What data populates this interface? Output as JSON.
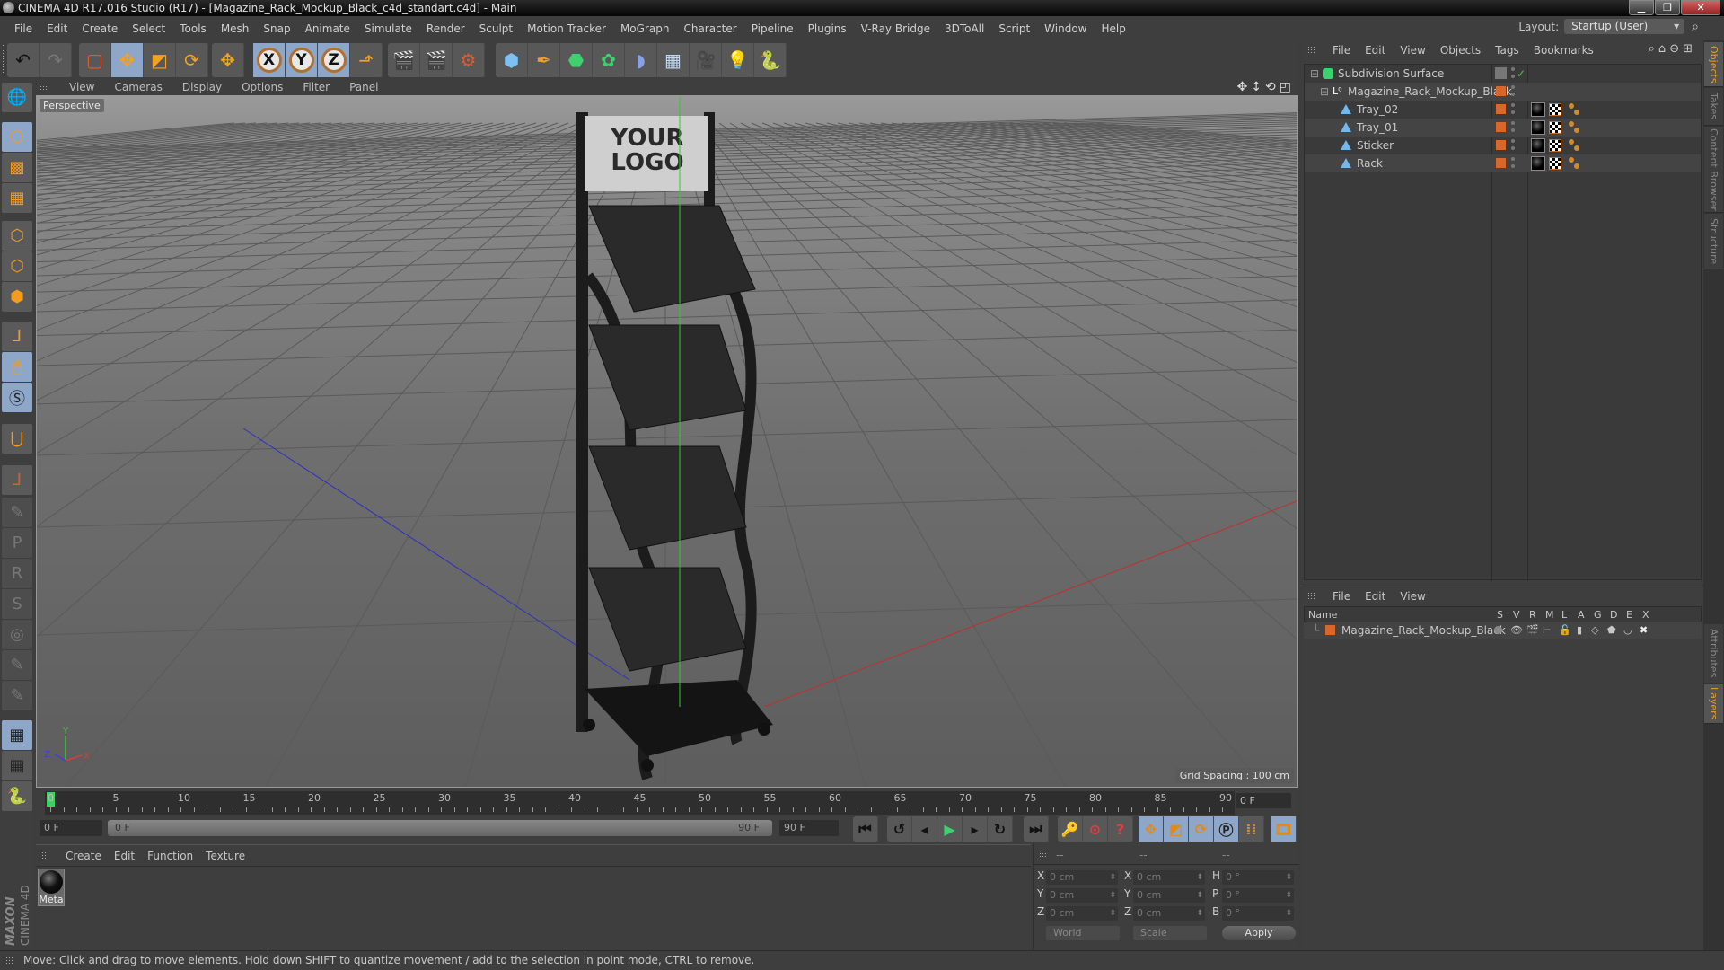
{
  "window": {
    "title": "CINEMA 4D R17.016 Studio (R17) - [Magazine_Rack_Mockup_Black_c4d_standart.c4d] - Main",
    "controls": [
      "minimize",
      "restore",
      "close"
    ]
  },
  "menubar": {
    "items": [
      "File",
      "Edit",
      "Create",
      "Select",
      "Tools",
      "Mesh",
      "Snap",
      "Animate",
      "Simulate",
      "Render",
      "Sculpt",
      "Motion Tracker",
      "MoGraph",
      "Character",
      "Pipeline",
      "Plugins",
      "V-Ray Bridge",
      "3DToAll",
      "Script",
      "Window",
      "Help"
    ],
    "layout_label": "Layout:",
    "layout_value": "Startup (User)"
  },
  "toolbar": {
    "groups": [
      [
        "undo-icon",
        "redo-icon"
      ],
      [
        "live-selection-icon",
        "move-icon",
        "scale-icon",
        "rotate-icon"
      ],
      [
        "last-tool-icon"
      ],
      [
        "x-axis-lock-icon",
        "y-axis-lock-icon",
        "z-axis-lock-icon",
        "coordinate-system-icon"
      ],
      [
        "render-view-icon",
        "render-picture-viewer-icon",
        "render-settings-icon"
      ],
      [
        "cube-icon",
        "pen-spline-icon",
        "subdivision-surface-icon",
        "cloner-icon",
        "deformer-icon",
        "floor-icon",
        "camera-icon",
        "light-icon",
        "python-icon"
      ]
    ],
    "axis_labels": [
      "X",
      "Y",
      "Z"
    ]
  },
  "left_toolbar": {
    "items": [
      "make-editable-icon",
      "model-mode-icon",
      "texture-mode-icon",
      "workplane-icon",
      "points-mode-icon",
      "edges-mode-icon",
      "polygons-mode-icon",
      "axis-mode-icon",
      "tweak-mode-icon",
      "solo-icon",
      "snap-magnet-icon",
      "workplane-axis-icon",
      "move-component-icon",
      "p-key-icon",
      "r-key-icon",
      "psr-key-icon",
      "keyframe-icon",
      "timeline-key-icon",
      "brush-icon",
      "locked-workplane-icon",
      "workplane-rotate-icon",
      "python-icon"
    ]
  },
  "viewport": {
    "menu": [
      "View",
      "Cameras",
      "Display",
      "Options",
      "Filter",
      "Panel"
    ],
    "camera_label": "Perspective",
    "grid_spacing": "Grid Spacing : 100 cm",
    "nav_icons": [
      "pan-icon",
      "dolly-icon",
      "orbit-icon",
      "maximize-view-icon"
    ],
    "sign_text": [
      "YOUR",
      "LOGO"
    ],
    "axis_gizmo": [
      "Y",
      "Z",
      "X"
    ]
  },
  "timeline": {
    "ticks": [
      "0",
      "5",
      "10",
      "15",
      "20",
      "25",
      "30",
      "35",
      "40",
      "45",
      "50",
      "55",
      "60",
      "65",
      "70",
      "75",
      "80",
      "85",
      "90"
    ],
    "current_frame": "0 F",
    "start_frame": "0 F",
    "range_start": "0 F",
    "range_end": "90 F",
    "end_frame": "90 F",
    "playhead_fraction": 0.0
  },
  "playback": {
    "buttons": [
      "go-to-start-icon",
      "previous-key-icon",
      "previous-frame-icon",
      "play-icon",
      "next-frame-icon",
      "next-key-icon",
      "go-to-end-icon"
    ],
    "record_buttons": [
      "motion-record-icon",
      "record-active-objects-icon",
      "autokeying-icon"
    ],
    "key_buttons": [
      "key-position-icon",
      "key-scale-icon",
      "key-rotation-icon",
      "key-parameter-icon",
      "key-point-level-icon"
    ],
    "timeline_button": "timeline-window-icon"
  },
  "material_manager": {
    "menu": [
      "Create",
      "Edit",
      "Function",
      "Texture"
    ],
    "materials": [
      {
        "name": "Meta"
      }
    ]
  },
  "brand": {
    "line1": "MAXON",
    "line2": "CINEMA 4D"
  },
  "coordinates": {
    "headers": [
      "--",
      "--",
      "--"
    ],
    "rows": [
      {
        "pos_label": "X",
        "pos": "0 cm",
        "size_label": "X",
        "size": "0 cm",
        "rot_label": "H",
        "rot": "0 °"
      },
      {
        "pos_label": "Y",
        "pos": "0 cm",
        "size_label": "Y",
        "size": "0 cm",
        "rot_label": "P",
        "rot": "0 °"
      },
      {
        "pos_label": "Z",
        "pos": "0 cm",
        "size_label": "Z",
        "size": "0 cm",
        "rot_label": "B",
        "rot": "0 °"
      }
    ],
    "mode": "World",
    "transform": "Scale",
    "apply_label": "Apply"
  },
  "object_manager": {
    "menu": [
      "File",
      "Edit",
      "View",
      "Objects",
      "Tags",
      "Bookmarks"
    ],
    "objects": [
      {
        "name": "Subdivision Surface",
        "type": "subdivision-surface",
        "depth": 0,
        "has_tags": false
      },
      {
        "name": "Magazine_Rack_Mockup_Black",
        "type": "null",
        "depth": 1,
        "has_tags": false
      },
      {
        "name": "Tray_02",
        "type": "polygon",
        "depth": 2,
        "has_tags": true
      },
      {
        "name": "Tray_01",
        "type": "polygon",
        "depth": 2,
        "has_tags": true
      },
      {
        "name": "Sticker",
        "type": "polygon",
        "depth": 2,
        "has_tags": true
      },
      {
        "name": "Rack",
        "type": "polygon",
        "depth": 2,
        "has_tags": true
      }
    ],
    "layer_color": "#d9662a"
  },
  "layer_manager": {
    "menu": [
      "File",
      "Edit",
      "View"
    ],
    "columns": [
      "Name",
      "S",
      "V",
      "R",
      "M",
      "L",
      "A",
      "G",
      "D",
      "E",
      "X"
    ],
    "layers": [
      {
        "name": "Magazine_Rack_Mockup_Black",
        "color": "#d9662a"
      }
    ]
  },
  "side_tabs": {
    "top": [
      {
        "label": "Objects",
        "active": true
      },
      {
        "label": "Takes",
        "active": false
      },
      {
        "label": "Content Browser",
        "active": false
      },
      {
        "label": "Structure",
        "active": false
      }
    ],
    "bottom": [
      {
        "label": "Attributes",
        "active": false
      },
      {
        "label": "Layers",
        "active": true
      }
    ]
  },
  "status": {
    "text": "Move: Click and drag to move elements. Hold down SHIFT to quantize movement / add to the selection in point mode, CTRL to remove."
  }
}
